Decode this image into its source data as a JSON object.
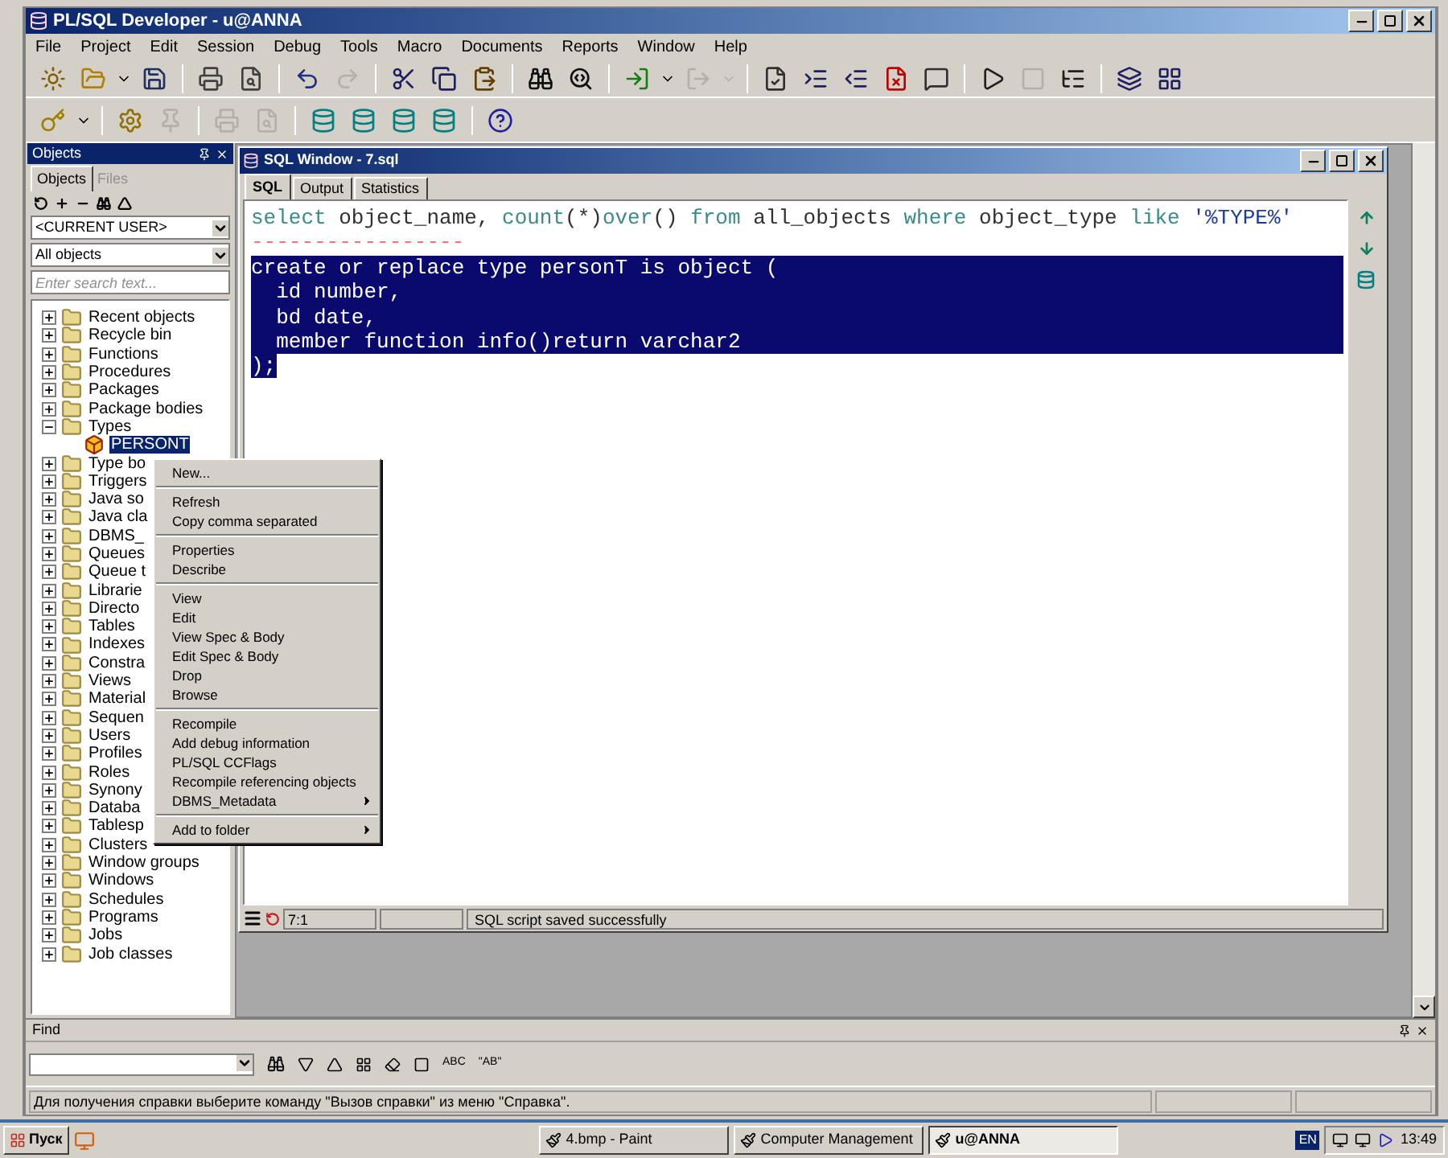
{
  "window": {
    "title": "PL/SQL Developer - u@ANNA"
  },
  "menu": [
    "File",
    "Project",
    "Edit",
    "Session",
    "Debug",
    "Tools",
    "Macro",
    "Documents",
    "Reports",
    "Window",
    "Help"
  ],
  "toolbar_main": [
    {
      "kind": "new",
      "disabled": false
    },
    {
      "kind": "open",
      "disabled": false
    },
    {
      "kind": "dropdown",
      "disabled": false
    },
    {
      "kind": "save",
      "disabled": false
    },
    {
      "kind": "separator"
    },
    {
      "kind": "print",
      "disabled": false
    },
    {
      "kind": "preview",
      "disabled": false
    },
    {
      "kind": "separator"
    },
    {
      "kind": "undo",
      "disabled": false
    },
    {
      "kind": "redo",
      "disabled": true
    },
    {
      "kind": "separator"
    },
    {
      "kind": "cut",
      "disabled": false
    },
    {
      "kind": "copy",
      "disabled": false
    },
    {
      "kind": "paste",
      "disabled": false
    },
    {
      "kind": "separator"
    },
    {
      "kind": "find",
      "disabled": false
    },
    {
      "kind": "findnext",
      "disabled": false
    },
    {
      "kind": "separator"
    },
    {
      "kind": "import",
      "disabled": false
    },
    {
      "kind": "dropdown",
      "disabled": false
    },
    {
      "kind": "export",
      "disabled": true
    },
    {
      "kind": "dropdown",
      "disabled": true
    },
    {
      "kind": "separator"
    },
    {
      "kind": "check",
      "disabled": false
    },
    {
      "kind": "indent",
      "disabled": false
    },
    {
      "kind": "unindent",
      "disabled": false
    },
    {
      "kind": "remove",
      "disabled": false
    },
    {
      "kind": "comment",
      "disabled": false
    },
    {
      "kind": "separator"
    },
    {
      "kind": "execute",
      "disabled": false
    },
    {
      "kind": "stop",
      "disabled": true
    },
    {
      "kind": "explain",
      "disabled": false
    },
    {
      "kind": "separator"
    },
    {
      "kind": "windows",
      "disabled": false
    },
    {
      "kind": "grid",
      "disabled": false
    }
  ],
  "toolbar_tools": [
    {
      "kind": "key",
      "disabled": false
    },
    {
      "kind": "dropdown",
      "disabled": false
    },
    {
      "kind": "separator"
    },
    {
      "kind": "gear",
      "disabled": false
    },
    {
      "kind": "pin",
      "disabled": true
    },
    {
      "kind": "separator"
    },
    {
      "kind": "print",
      "disabled": true
    },
    {
      "kind": "preview",
      "disabled": true
    },
    {
      "kind": "separator"
    },
    {
      "kind": "db",
      "disabled": false
    },
    {
      "kind": "db",
      "disabled": false
    },
    {
      "kind": "db",
      "disabled": false
    },
    {
      "kind": "db",
      "disabled": false
    },
    {
      "kind": "separator"
    },
    {
      "kind": "help",
      "disabled": false
    }
  ],
  "objects_panel": {
    "title": "Objects",
    "tabs": [
      {
        "label": "Objects",
        "selected": true
      },
      {
        "label": "Files",
        "selected": false
      }
    ],
    "owner": "<CURRENT USER>",
    "filter": "All objects",
    "search": {
      "placeholder": "Enter search text..."
    },
    "tree": [
      {
        "label": "Recent objects",
        "kind": "folder",
        "expanded": false,
        "selected": false
      },
      {
        "label": "Recycle bin",
        "kind": "folder",
        "expanded": false,
        "selected": false
      },
      {
        "label": "Functions",
        "kind": "folder",
        "expanded": false,
        "selected": false
      },
      {
        "label": "Procedures",
        "kind": "folder",
        "expanded": false,
        "selected": false
      },
      {
        "label": "Packages",
        "kind": "folder",
        "expanded": false,
        "selected": false
      },
      {
        "label": "Package bodies",
        "kind": "folder",
        "expanded": false,
        "selected": false
      },
      {
        "label": "Types",
        "kind": "folder",
        "expanded": true,
        "selected": false,
        "children": [
          {
            "label": "PERSONT",
            "kind": "type",
            "selected": true
          }
        ]
      },
      {
        "label": "Type bo",
        "kind": "folder",
        "expanded": false,
        "selected": false
      },
      {
        "label": "Triggers",
        "kind": "folder",
        "expanded": false,
        "selected": false
      },
      {
        "label": "Java so",
        "kind": "folder",
        "expanded": false,
        "selected": false
      },
      {
        "label": "Java cla",
        "kind": "folder",
        "expanded": false,
        "selected": false
      },
      {
        "label": "DBMS_",
        "kind": "folder",
        "expanded": false,
        "selected": false
      },
      {
        "label": "Queues",
        "kind": "folder",
        "expanded": false,
        "selected": false
      },
      {
        "label": "Queue t",
        "kind": "folder",
        "expanded": false,
        "selected": false
      },
      {
        "label": "Librarie",
        "kind": "folder",
        "expanded": false,
        "selected": false
      },
      {
        "label": "Directo",
        "kind": "folder",
        "expanded": false,
        "selected": false
      },
      {
        "label": "Tables",
        "kind": "folder",
        "expanded": false,
        "selected": false
      },
      {
        "label": "Indexes",
        "kind": "folder",
        "expanded": false,
        "selected": false
      },
      {
        "label": "Constra",
        "kind": "folder",
        "expanded": false,
        "selected": false
      },
      {
        "label": "Views",
        "kind": "folder",
        "expanded": false,
        "selected": false
      },
      {
        "label": "Material",
        "kind": "folder",
        "expanded": false,
        "selected": false
      },
      {
        "label": "Sequen",
        "kind": "folder",
        "expanded": false,
        "selected": false
      },
      {
        "label": "Users",
        "kind": "folder",
        "expanded": false,
        "selected": false
      },
      {
        "label": "Profiles",
        "kind": "folder",
        "expanded": false,
        "selected": false
      },
      {
        "label": "Roles",
        "kind": "folder",
        "expanded": false,
        "selected": false
      },
      {
        "label": "Synony",
        "kind": "folder",
        "expanded": false,
        "selected": false
      },
      {
        "label": "Databa",
        "kind": "folder",
        "expanded": false,
        "selected": false
      },
      {
        "label": "Tablesp",
        "kind": "folder",
        "expanded": false,
        "selected": false
      },
      {
        "label": "Clusters",
        "kind": "folder",
        "expanded": false,
        "selected": false
      },
      {
        "label": "Window groups",
        "kind": "folder",
        "expanded": false,
        "selected": false
      },
      {
        "label": "Windows",
        "kind": "folder",
        "expanded": false,
        "selected": false
      },
      {
        "label": "Schedules",
        "kind": "folder",
        "expanded": false,
        "selected": false
      },
      {
        "label": "Programs",
        "kind": "folder",
        "expanded": false,
        "selected": false
      },
      {
        "label": "Jobs",
        "kind": "folder",
        "expanded": false,
        "selected": false
      },
      {
        "label": "Job classes",
        "kind": "folder",
        "expanded": false,
        "selected": false
      }
    ]
  },
  "context_menu": [
    {
      "kind": "item",
      "label": "New...",
      "submenu": false
    },
    {
      "kind": "separator"
    },
    {
      "kind": "item",
      "label": "Refresh",
      "submenu": false
    },
    {
      "kind": "item",
      "label": "Copy comma separated",
      "submenu": false
    },
    {
      "kind": "separator"
    },
    {
      "kind": "item",
      "label": "Properties",
      "submenu": false
    },
    {
      "kind": "item",
      "label": "Describe",
      "submenu": false
    },
    {
      "kind": "separator"
    },
    {
      "kind": "item",
      "label": "View",
      "submenu": false
    },
    {
      "kind": "item",
      "label": "Edit",
      "submenu": false
    },
    {
      "kind": "item",
      "label": "View Spec & Body",
      "submenu": false
    },
    {
      "kind": "item",
      "label": "Edit Spec & Body",
      "submenu": false
    },
    {
      "kind": "item",
      "label": "Drop",
      "submenu": false
    },
    {
      "kind": "item",
      "label": "Browse",
      "submenu": false
    },
    {
      "kind": "separator"
    },
    {
      "kind": "item",
      "label": "Recompile",
      "submenu": false
    },
    {
      "kind": "item",
      "label": "Add debug information",
      "submenu": false
    },
    {
      "kind": "item",
      "label": "PL/SQL CCFlags",
      "submenu": false
    },
    {
      "kind": "item",
      "label": "Recompile referencing objects",
      "submenu": false
    },
    {
      "kind": "item",
      "label": "DBMS_Metadata",
      "submenu": true
    },
    {
      "kind": "separator"
    },
    {
      "kind": "item",
      "label": "Add to folder",
      "submenu": true
    }
  ],
  "sql_window": {
    "title": "SQL Window - 7.sql",
    "tabs": [
      {
        "label": "SQL",
        "selected": true
      },
      {
        "label": "Output",
        "selected": false
      },
      {
        "label": "Statistics",
        "selected": false
      }
    ],
    "lines": [
      {
        "selected": false,
        "tokens": [
          {
            "kind": "keyword",
            "text": "select"
          },
          {
            "kind": "plain",
            "text": " object_name, "
          },
          {
            "kind": "keyword",
            "text": "count"
          },
          {
            "kind": "plain",
            "text": "(*)"
          },
          {
            "kind": "keyword",
            "text": "over"
          },
          {
            "kind": "plain",
            "text": "() "
          },
          {
            "kind": "keyword",
            "text": "from"
          },
          {
            "kind": "plain",
            "text": " all_objects "
          },
          {
            "kind": "keyword",
            "text": "where"
          },
          {
            "kind": "plain",
            "text": " object_type "
          },
          {
            "kind": "keyword",
            "text": "like"
          },
          {
            "kind": "string",
            "text": " '%TYPE%'"
          }
        ]
      },
      {
        "selected": false,
        "tokens": [
          {
            "kind": "comment",
            "text": "-----------------"
          }
        ]
      },
      {
        "selected": true,
        "text": "create or replace type personT is object ("
      },
      {
        "selected": true,
        "text": "  id number,"
      },
      {
        "selected": true,
        "text": "  bd date,"
      },
      {
        "selected": true,
        "text": "  member function info()return varchar2"
      },
      {
        "selected": true,
        "text": ");"
      }
    ],
    "position": "7:1",
    "message": "SQL script saved successfully"
  },
  "find_bar": {
    "title": "Find",
    "search_label_abc": "ABC",
    "search_label_ab": "\"AB\""
  },
  "status_bar": "Для получения справки выберите команду \"Вызов справки\" из меню \"Справка\".",
  "taskbar": {
    "start": "Пуск",
    "tasks": [
      {
        "label": "4.bmp - Paint",
        "selected": false
      },
      {
        "label": "Computer Management",
        "selected": false
      },
      {
        "label": "u@ANNA",
        "selected": true
      }
    ],
    "language": "EN",
    "clock": "13:49"
  }
}
